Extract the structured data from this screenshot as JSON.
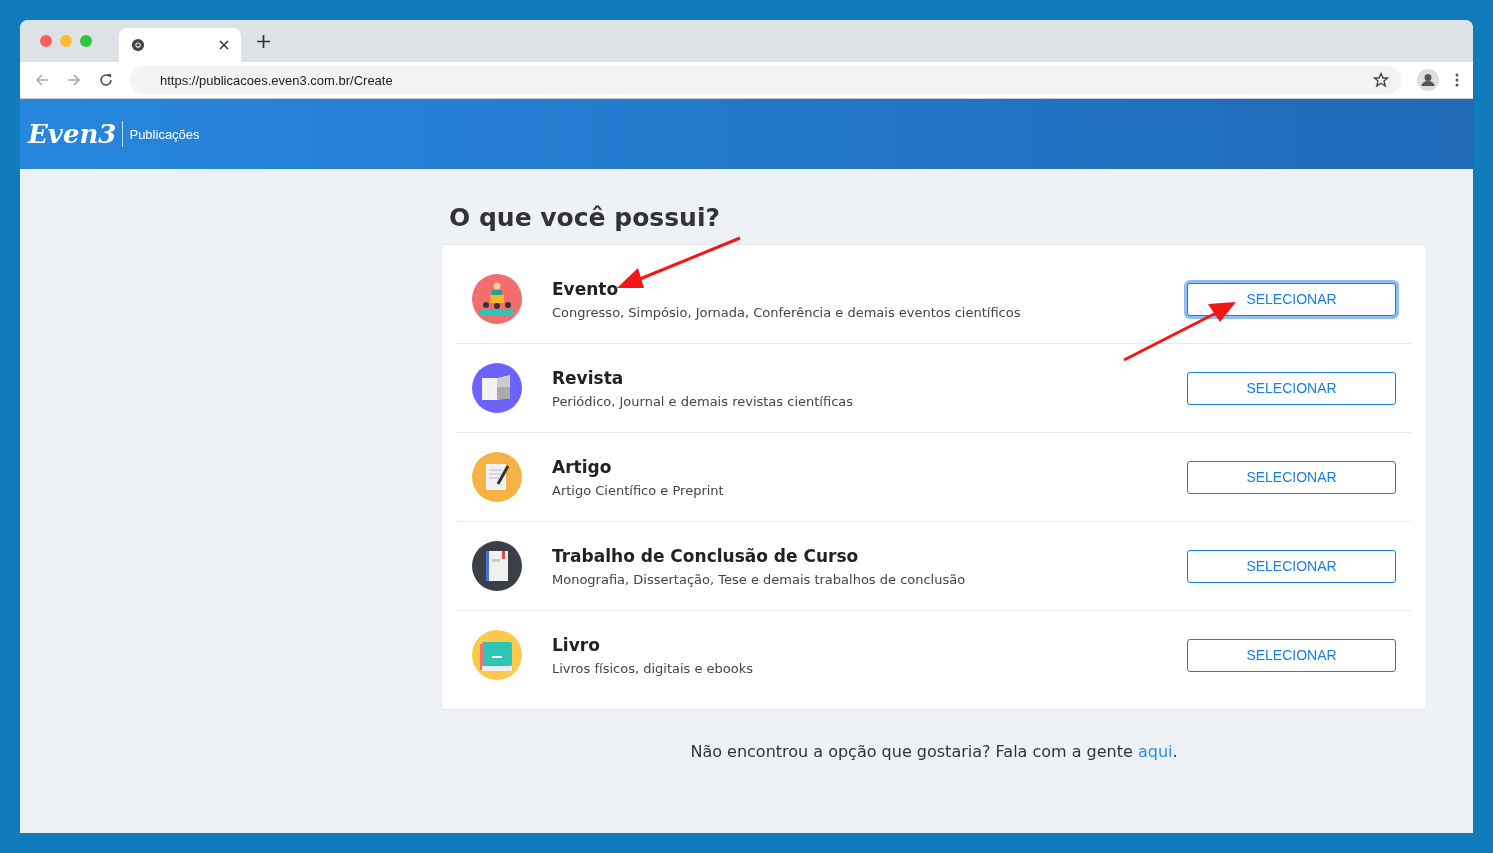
{
  "browser": {
    "url": "https://publicacoes.even3.com.br/Create"
  },
  "header": {
    "logo": "Even3",
    "section": "Publicações"
  },
  "title": "O que você possui?",
  "options": [
    {
      "kind": "event",
      "title": "Evento",
      "description": "Congresso, Simpósio, Jornada, Conferência e demais eventos científicos",
      "button": "SELECIONAR",
      "focused": true
    },
    {
      "kind": "journal",
      "title": "Revista",
      "description": "Periódico, Journal e demais revistas científicas",
      "button": "SELECIONAR",
      "focused": false
    },
    {
      "kind": "article",
      "title": "Artigo",
      "description": "Artigo Científico e Preprint",
      "button": "SELECIONAR",
      "focused": false
    },
    {
      "kind": "thesis",
      "title": "Trabalho de Conclusão de Curso",
      "description": "Monografia, Dissertação, Tese e demais trabalhos de conclusão",
      "button": "SELECIONAR",
      "focused": false
    },
    {
      "kind": "book",
      "title": "Livro",
      "description": "Livros físicos, digitais e ebooks",
      "button": "SELECIONAR",
      "focused": false
    }
  ],
  "footer": {
    "text": "Não encontrou a opção que gostaria? Fala com a gente",
    "link": "aqui",
    "end": "."
  }
}
